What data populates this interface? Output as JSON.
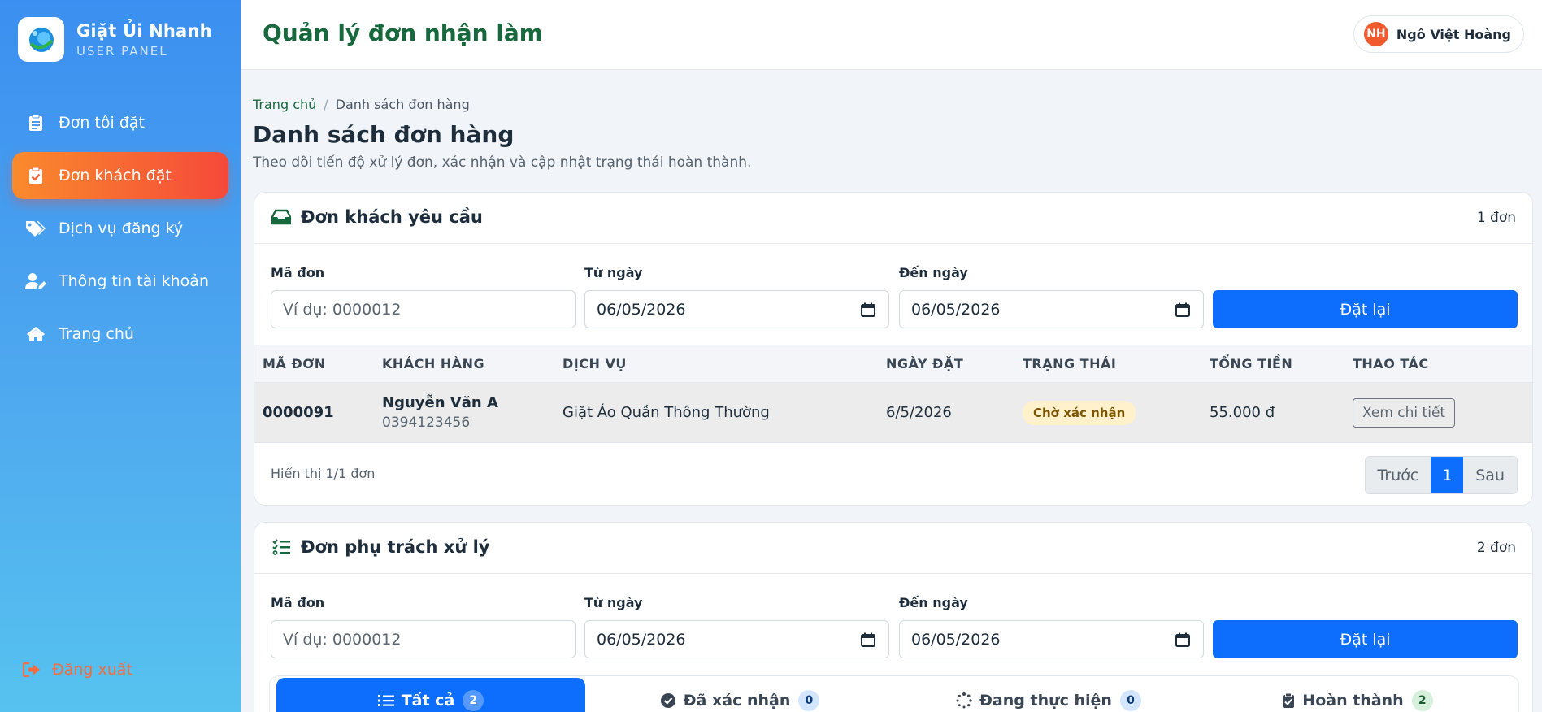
{
  "brand": {
    "name": "Giặt Ủi Nhanh",
    "subtitle": "USER PANEL"
  },
  "sidebar": {
    "items": [
      {
        "label": "Đơn tôi đặt",
        "icon": "clipboard-list-icon",
        "active": false
      },
      {
        "label": "Đơn khách đặt",
        "icon": "clipboard-check-icon",
        "active": true
      },
      {
        "label": "Dịch vụ đăng ký",
        "icon": "tags-icon",
        "active": false
      },
      {
        "label": "Thông tin tài khoản",
        "icon": "user-edit-icon",
        "active": false
      },
      {
        "label": "Trang chủ",
        "icon": "home-icon",
        "active": false
      }
    ],
    "logout": "Đăng xuất"
  },
  "header": {
    "title": "Quản lý đơn nhận làm",
    "user": {
      "initials": "NH",
      "name": "Ngô Việt Hoàng"
    }
  },
  "breadcrumb": {
    "home": "Trang chủ",
    "current": "Danh sách đơn hàng"
  },
  "page": {
    "title": "Danh sách đơn hàng",
    "subtitle": "Theo dõi tiến độ xử lý đơn, xác nhận và cập nhật trạng thái hoàn thành."
  },
  "requests": {
    "title": "Đơn khách yêu cầu",
    "count": "1 đơn",
    "filters": {
      "code_label": "Mã đơn",
      "code_placeholder": "Ví dụ: 0000012",
      "from_label": "Từ ngày",
      "from_value": "06/05/2026",
      "to_label": "Đến ngày",
      "to_value": "06/05/2026",
      "reset": "Đặt lại"
    },
    "columns": [
      "MÃ ĐƠN",
      "KHÁCH HÀNG",
      "DỊCH VỤ",
      "NGÀY ĐẶT",
      "TRẠNG THÁI",
      "TỔNG TIỀN",
      "THAO TÁC"
    ],
    "rows": [
      {
        "code": "0000091",
        "customer": "Nguyễn Văn A",
        "phone": "0394123456",
        "service": "Giặt Áo Quần Thông Thường",
        "date": "6/5/2026",
        "status": "Chờ xác nhận",
        "total": "55.000 đ",
        "action": "Xem chi tiết"
      }
    ],
    "showing": "Hiển thị 1/1 đơn",
    "pager": {
      "prev": "Trước",
      "current": "1",
      "next": "Sau"
    }
  },
  "assigned": {
    "title": "Đơn phụ trách xử lý",
    "count": "2 đơn",
    "filters": {
      "code_label": "Mã đơn",
      "code_placeholder": "Ví dụ: 0000012",
      "from_label": "Từ ngày",
      "from_value": "06/05/2026",
      "to_label": "Đến ngày",
      "to_value": "06/05/2026",
      "reset": "Đặt lại"
    },
    "tabs": [
      {
        "label": "Tất cả",
        "count": "2",
        "icon": "list-icon",
        "active": true
      },
      {
        "label": "Đã xác nhận",
        "count": "0",
        "icon": "check-circle-icon",
        "active": false
      },
      {
        "label": "Đang thực hiện",
        "count": "0",
        "icon": "spinner-icon",
        "active": false
      },
      {
        "label": "Hoàn thành",
        "count": "2",
        "icon": "clipboard-check-icon",
        "active": false
      }
    ]
  },
  "colors": {
    "sidebar_top": "#3b8ff0",
    "sidebar_bottom": "#56c2ef",
    "active_nav": "#f5493a",
    "primary": "#0d6efd",
    "title_green": "#17683d",
    "logout": "#f46b3c"
  }
}
